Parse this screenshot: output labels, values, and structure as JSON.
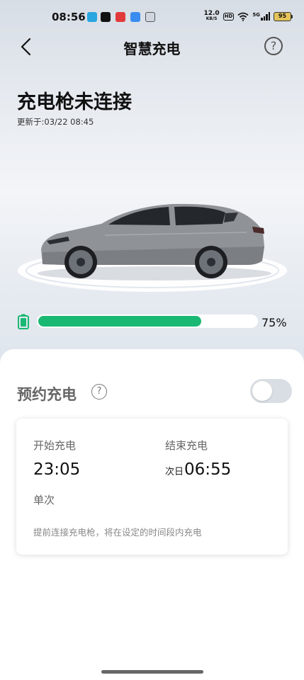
{
  "status_bar": {
    "time": "08:56",
    "net_speed": "12.0",
    "net_unit": "KB/S",
    "hd": "HD",
    "signal": "5G",
    "battery": "95"
  },
  "header": {
    "title": "智慧充电"
  },
  "charge_status": {
    "title": "充电枪未连接",
    "updated": "更新于:03/22 08:45"
  },
  "battery_level": {
    "value": 0.75,
    "label": "75%"
  },
  "schedule": {
    "title": "预约充电",
    "toggle_on": false,
    "start_label": "开始充电",
    "start_time": "23:05",
    "end_label": "结束充电",
    "end_prefix": "次日",
    "end_time": "06:55",
    "repeat": "单次",
    "note": "提前连接充电枪，将在设定的时间段内充电"
  },
  "colors": {
    "accent": "#1ab973",
    "toggle_off": "#d8dee3"
  }
}
